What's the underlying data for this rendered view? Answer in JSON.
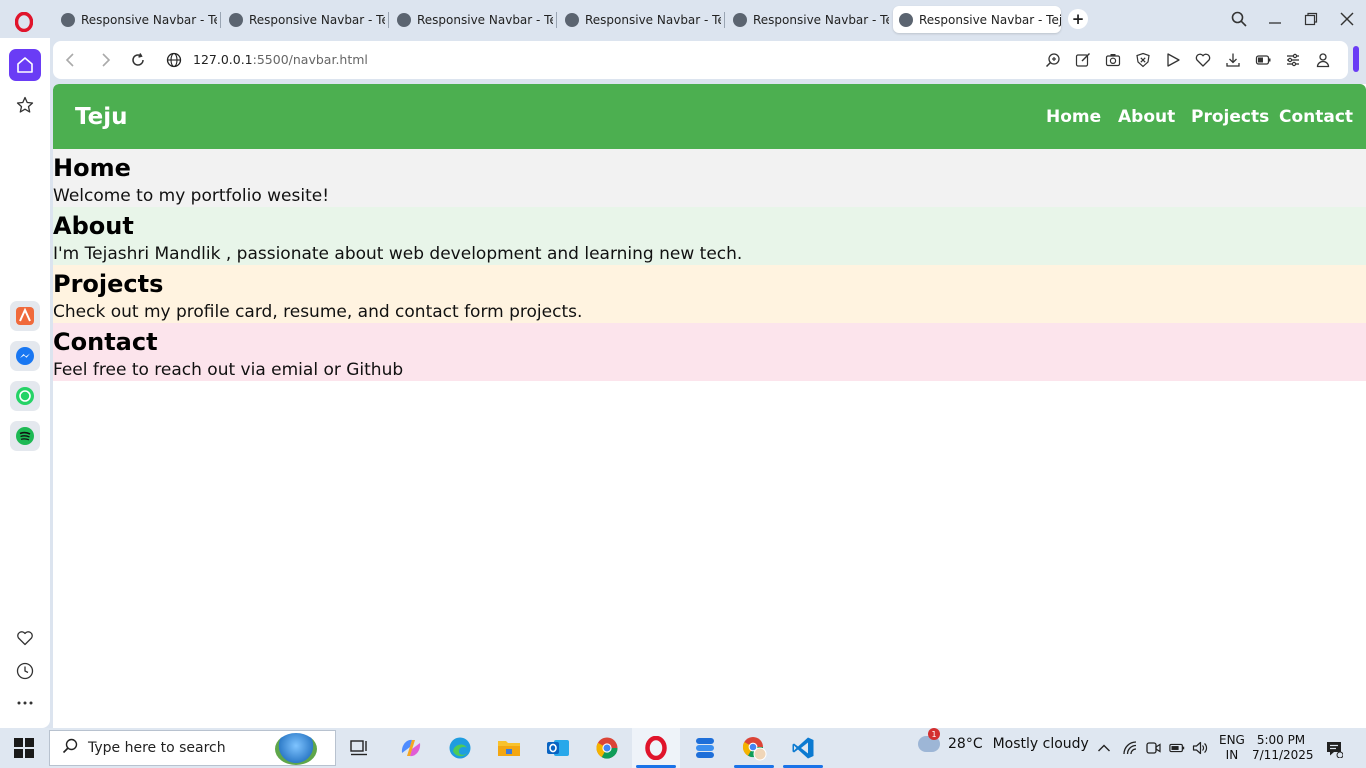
{
  "browser": {
    "tabs": [
      {
        "title": "Responsive Navbar - Teju",
        "active": false
      },
      {
        "title": "Responsive Navbar - Teju",
        "active": false
      },
      {
        "title": "Responsive Navbar - Teju",
        "active": false
      },
      {
        "title": "Responsive Navbar - Teju",
        "active": false
      },
      {
        "title": "Responsive Navbar - Teju",
        "active": false
      },
      {
        "title": "Responsive Navbar - Teju",
        "active": true
      }
    ],
    "address": {
      "host": "127.0.0.1",
      "path": ":5500/navbar.html"
    },
    "accent_color": "#6a3cf5"
  },
  "page": {
    "navbar": {
      "brand": "Teju",
      "links": [
        "Home",
        "About",
        "Projects",
        "Contact"
      ],
      "color": "#4caf50"
    },
    "sections": [
      {
        "heading": "Home",
        "text": "Welcome to my portfolio wesite!",
        "color": "#f2f2f2"
      },
      {
        "heading": "About",
        "text": "I'm Tejashri Mandlik , passionate about web development and learning new tech.",
        "color": "#e8f5e9"
      },
      {
        "heading": "Projects",
        "text": "Check out my profile card, resume, and contact form projects.",
        "color": "#fff3e0"
      },
      {
        "heading": "Contact",
        "text": "Feel free to reach out via emial or Github",
        "color": "#fce4ec"
      }
    ]
  },
  "taskbar": {
    "search_placeholder": "Type here to search",
    "weather": {
      "temp": "28°C",
      "condition": "Mostly cloudy",
      "alert_count": "1"
    },
    "language": {
      "line1": "ENG",
      "line2": "IN"
    },
    "clock": {
      "time": "5:00 PM",
      "date": "7/11/2025"
    }
  }
}
